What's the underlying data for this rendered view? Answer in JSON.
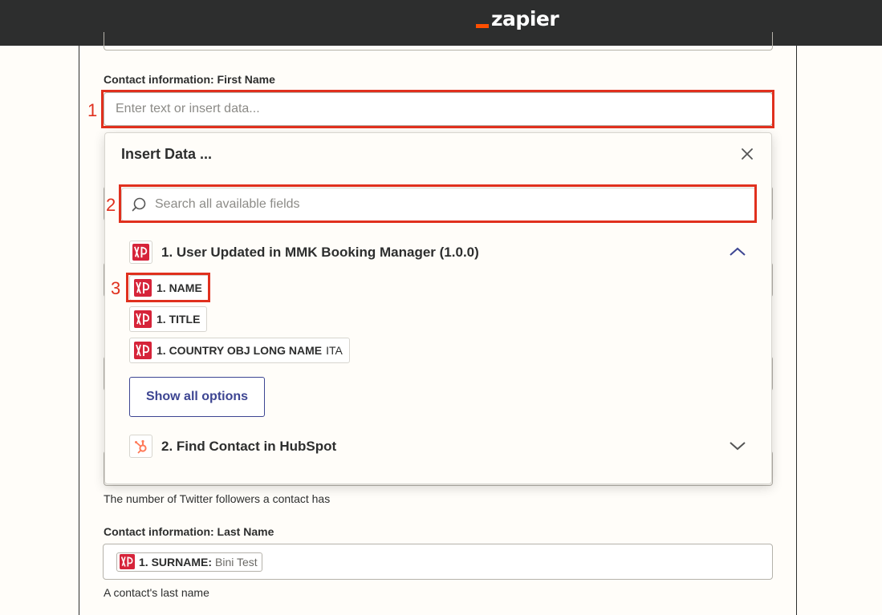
{
  "app": {
    "logo_text": "zapier"
  },
  "form": {
    "first_name": {
      "label": "Contact information: First Name",
      "placeholder": "Enter text or insert data..."
    },
    "twitter_help": "The number of Twitter followers a contact has",
    "last_name": {
      "label": "Contact information: Last Name",
      "token_label": "1. SURNAME:",
      "token_value": "Bini Test",
      "help": "A contact's last name"
    }
  },
  "insert_data": {
    "title": "Insert Data ...",
    "close_icon": "close-icon",
    "search_placeholder": "Search all available fields",
    "steps": [
      {
        "title": "1. User Updated in MMK Booking Manager (1.0.0)",
        "expanded": true,
        "fields": [
          {
            "label": "1. NAME",
            "sample": ""
          },
          {
            "label": "1. TITLE",
            "sample": ""
          },
          {
            "label": "1. COUNTRY OBJ LONG NAME",
            "sample": "ITA"
          }
        ],
        "show_all_label": "Show all options"
      },
      {
        "title": "2. Find Contact in HubSpot",
        "expanded": false
      }
    ]
  },
  "annotations": [
    "1",
    "2",
    "3"
  ],
  "colors": {
    "topbar": "#2d2e2e",
    "zapier_orange": "#ff4f00",
    "callout_red": "#e0301e",
    "mmk_red": "#d6243a",
    "hubspot_orange": "#ff7a59",
    "link_blue": "#3d4592"
  }
}
